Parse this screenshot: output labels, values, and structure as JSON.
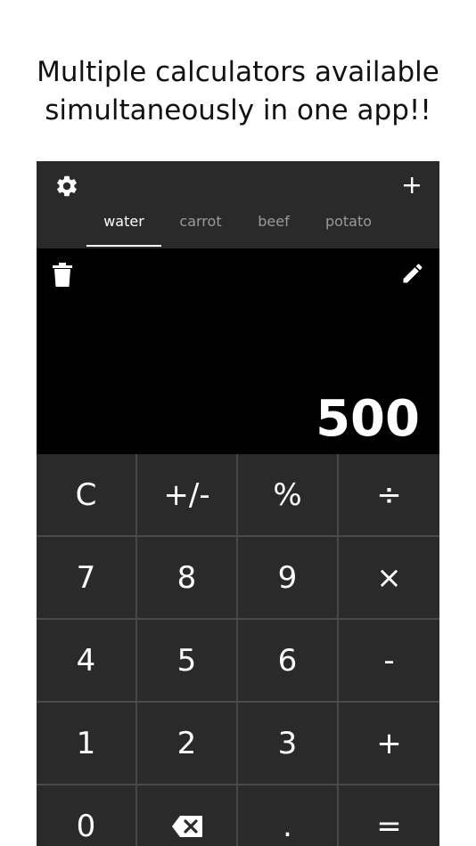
{
  "headline": {
    "line1": "Multiple calculators available",
    "line2": "simultaneously in one app!!"
  },
  "toolbar": {
    "settings_icon": "gear-icon",
    "add_icon": "plus-icon",
    "add_label": "+"
  },
  "tabs": [
    {
      "label": "water",
      "active": true
    },
    {
      "label": "carrot",
      "active": false
    },
    {
      "label": "beef",
      "active": false
    },
    {
      "label": "potato",
      "active": false
    }
  ],
  "display": {
    "value": "500",
    "delete_icon": "trash-icon",
    "rename_icon": "pencil-icon"
  },
  "keys": {
    "clear": "C",
    "sign": "+/-",
    "percent": "%",
    "divide": "÷",
    "seven": "7",
    "eight": "8",
    "nine": "9",
    "multiply": "×",
    "four": "4",
    "five": "5",
    "six": "6",
    "minus": "-",
    "one": "1",
    "two": "2",
    "three": "3",
    "plus": "+",
    "zero": "0",
    "backspace_icon": "backspace-icon",
    "decimal": ".",
    "equals": "="
  },
  "colors": {
    "panel": "#2a2a2a",
    "display": "#000000",
    "divider": "#474747",
    "active_tab": "#ffffff",
    "inactive_tab": "#9a9a9a"
  }
}
